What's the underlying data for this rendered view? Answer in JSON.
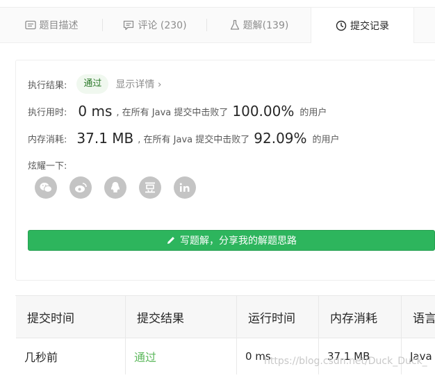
{
  "tabs": [
    {
      "label": "题目描述",
      "icon": "description-icon"
    },
    {
      "label": "评论 (230)",
      "icon": "comment-icon"
    },
    {
      "label": "题解(139)",
      "icon": "flask-icon"
    },
    {
      "label": "提交记录",
      "icon": "clock-icon",
      "active": true
    }
  ],
  "result": {
    "label": "执行结果:",
    "status": "通过",
    "detail_link": "显示详情 ›"
  },
  "runtime": {
    "label": "执行用时:",
    "value": "0 ms",
    "text_before": ", 在所有 Java 提交中击败了",
    "percent": "100.00%",
    "text_after": "的用户"
  },
  "memory": {
    "label": "内存消耗:",
    "value": "37.1 MB",
    "text_before": ", 在所有 Java 提交中击败了",
    "percent": "92.09%",
    "text_after": "的用户"
  },
  "share": {
    "label": "炫耀一下:",
    "icons": [
      "wechat-icon",
      "weibo-icon",
      "qq-icon",
      "douban-icon",
      "linkedin-icon"
    ]
  },
  "write_button": {
    "label": "写题解，分享我的解题思路"
  },
  "table": {
    "headers": [
      "提交时间",
      "提交结果",
      "运行时间",
      "内存消耗",
      "语言"
    ],
    "rows": [
      [
        "几秒前",
        "通过",
        "0 ms",
        "37.1 MB",
        "Java"
      ]
    ]
  },
  "watermark": "https://blog.csdn.net/Duck_Duck_",
  "colors": {
    "accent": "#2db55d",
    "pass": "#5cb85c",
    "pill_bg": "#f0f8ef"
  }
}
